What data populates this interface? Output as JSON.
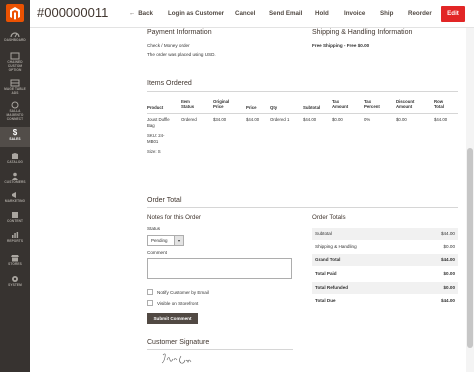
{
  "sidebar": {
    "items": [
      {
        "label": "DASHBOARD",
        "icon": "dashboard-icon"
      },
      {
        "label": "CHAINED\nCUSTOM\nOPTION",
        "icon": "chain-icon"
      },
      {
        "label": "MAGE TABLE\nADS",
        "icon": "table-icon"
      },
      {
        "label": "SALLA\nMAGENTO\nCONNECT",
        "icon": "connect-icon"
      },
      {
        "label": "SALES",
        "icon": "dollar-icon"
      },
      {
        "label": "CATALOG",
        "icon": "box-icon"
      },
      {
        "label": "CUSTOMERS",
        "icon": "person-icon"
      },
      {
        "label": "MARKETING",
        "icon": "megaphone-icon"
      },
      {
        "label": "CONTENT",
        "icon": "layout-icon"
      },
      {
        "label": "REPORTS",
        "icon": "bar-chart-icon"
      },
      {
        "label": "STORES",
        "icon": "store-icon"
      },
      {
        "label": "SYSTEM",
        "icon": "gear-icon"
      }
    ]
  },
  "header": {
    "title": "#000000011",
    "buttons": {
      "back": "Back",
      "login_as_customer": "Login as Customer",
      "cancel": "Cancel",
      "send_email": "Send Email",
      "hold": "Hold",
      "invoice": "Invoice",
      "ship": "Ship",
      "reorder": "Reorder",
      "edit": "Edit"
    }
  },
  "payment": {
    "heading": "Payment Information",
    "method": "Check / Money order",
    "currency_note": "The order was placed using USD."
  },
  "shipping": {
    "heading": "Shipping & Handling Information",
    "method": "Free Shipping - Free $0.00"
  },
  "items": {
    "heading": "Items Ordered",
    "columns": [
      "Product",
      "Item\nStatus",
      "Original\nPrice",
      "Price",
      "Qty",
      "Subtotal",
      "Tax\nAmount",
      "Tax\nPercent",
      "Discount\nAmount",
      "Row\nTotal"
    ],
    "rows": [
      {
        "product": "Joust Duffle\nBag",
        "sku": "SKU: 24-\nMB01",
        "size": "Size: S",
        "status": "Ordered",
        "original_price": "$34.00",
        "price": "$44.00",
        "qty": "Ordered 1",
        "subtotal": "$44.00",
        "tax_amount": "$0.00",
        "tax_percent": "0%",
        "discount": "$0.00",
        "row_total": "$44.00"
      }
    ]
  },
  "order_total": {
    "heading": "Order Total",
    "notes": {
      "heading": "Notes for this Order",
      "status_label": "Status",
      "status_value": "Pending",
      "comment_label": "Comment",
      "notify_label": "Notify Customer by Email",
      "visible_label": "Visible on Storefront",
      "submit_label": "Submit Comment"
    },
    "totals": {
      "heading": "Order Totals",
      "rows": [
        {
          "label": "Subtotal",
          "value": "$44.00"
        },
        {
          "label": "Shipping & Handling",
          "value": "$0.00"
        },
        {
          "label": "Grand Total",
          "value": "$44.00"
        },
        {
          "label": "Total Paid",
          "value": "$0.00"
        },
        {
          "label": "Total Refunded",
          "value": "$0.00"
        },
        {
          "label": "Total Due",
          "value": "$44.00"
        }
      ]
    }
  },
  "signature": {
    "heading": "Customer Signature"
  },
  "colors": {
    "sidebar_bg": "#373330",
    "accent": "#eb5202",
    "edit_button": "#e22626",
    "dark_button": "#514943"
  }
}
